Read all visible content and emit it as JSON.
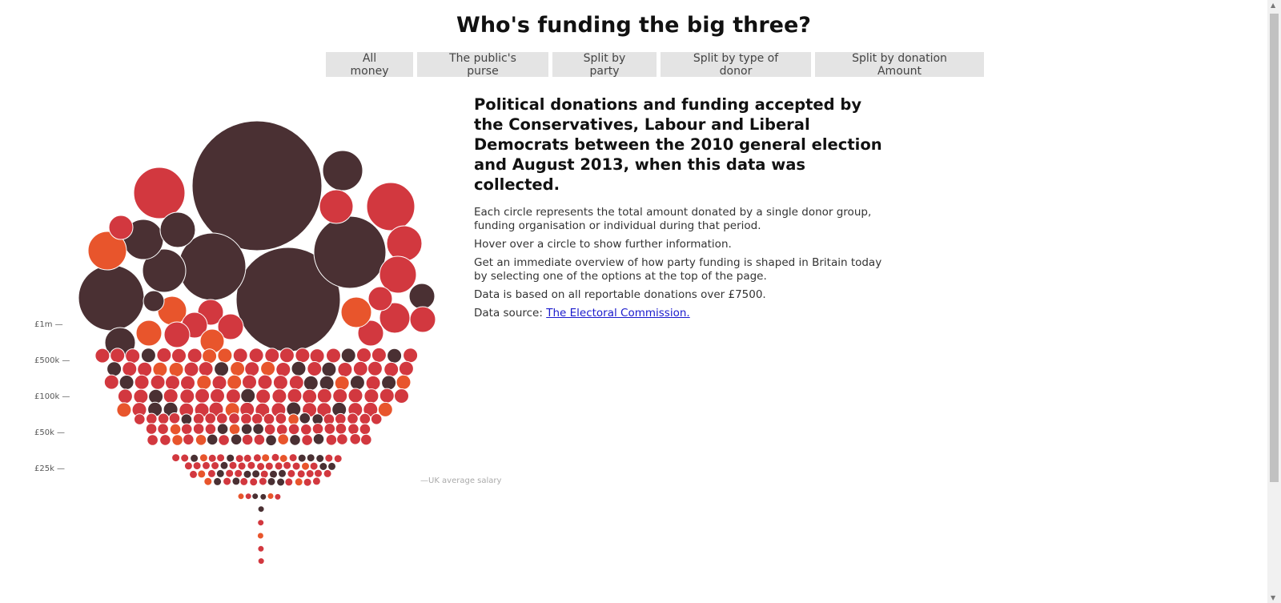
{
  "page": {
    "title": "Who's funding the big three?",
    "tabs": [
      "All money",
      "The public's purse",
      "Split by party",
      "Split by type of donor",
      "Split by donation Amount"
    ]
  },
  "intro": {
    "headline": "Political donations and funding accepted by the Conservatives, Labour and Liberal Democrats between the 2010 general election and August 2013, when this data was collected.",
    "p1": "Each circle represents the total amount donated by a single donor group, funding organisation or individual during that period.",
    "p2": "Hover over a circle to show further information.",
    "p3": "Get an immediate overview of how party funding is shaped in Britain today by selecting one of the options at the top of the page.",
    "p4": "Data is based on all reportable donations over £7500.",
    "source_label": "Data source: ",
    "source_link": "The Electoral Commission."
  },
  "scale": {
    "labels": [
      "£1m —",
      "£500k —",
      "£100k —",
      "£50k —",
      "£25k —"
    ],
    "salary_note": "—UK average salary"
  },
  "colors": {
    "dark": "#4a3033",
    "red": "#d2383f",
    "orange": "#e8552c"
  },
  "icons": {
    "scroll_up": "triangle-up-icon",
    "scroll_down": "triangle-down-icon"
  }
}
